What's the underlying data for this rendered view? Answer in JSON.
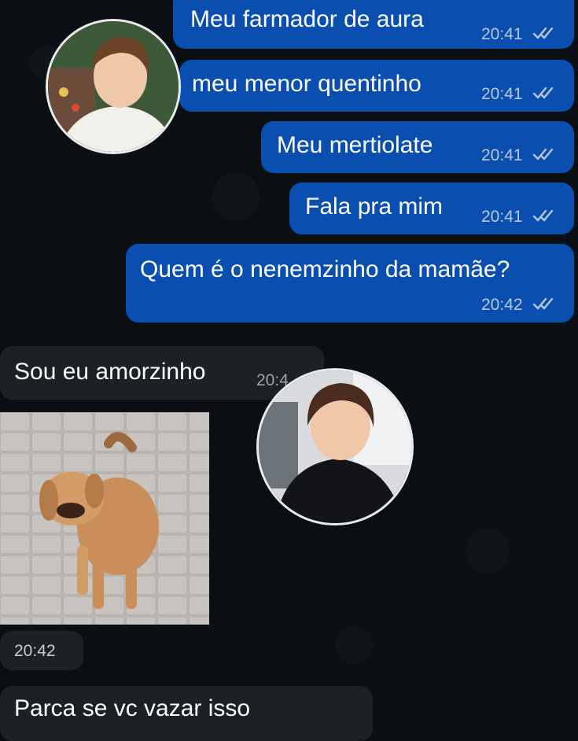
{
  "messages": [
    {
      "text": "Meu farmador de aura",
      "time": "20:41"
    },
    {
      "text": "meu menor quentinho",
      "time": "20:41"
    },
    {
      "text": "Meu mertiolate",
      "time": "20:41"
    },
    {
      "text": "Fala pra mim",
      "time": "20:41"
    },
    {
      "text": "Quem é o nenemzinho da mamãe?",
      "time": "20:42"
    },
    {
      "text": "Sou eu amorzinho",
      "time": "20:4"
    },
    {
      "text": "Parca se vc vazar isso"
    }
  ],
  "media": {
    "time": "20:42"
  },
  "colors": {
    "outgoing": "#0a4fb0",
    "incoming": "#1d2126",
    "background": "#0b0f14"
  },
  "icons": {
    "read_receipt": "double-check-icon"
  }
}
